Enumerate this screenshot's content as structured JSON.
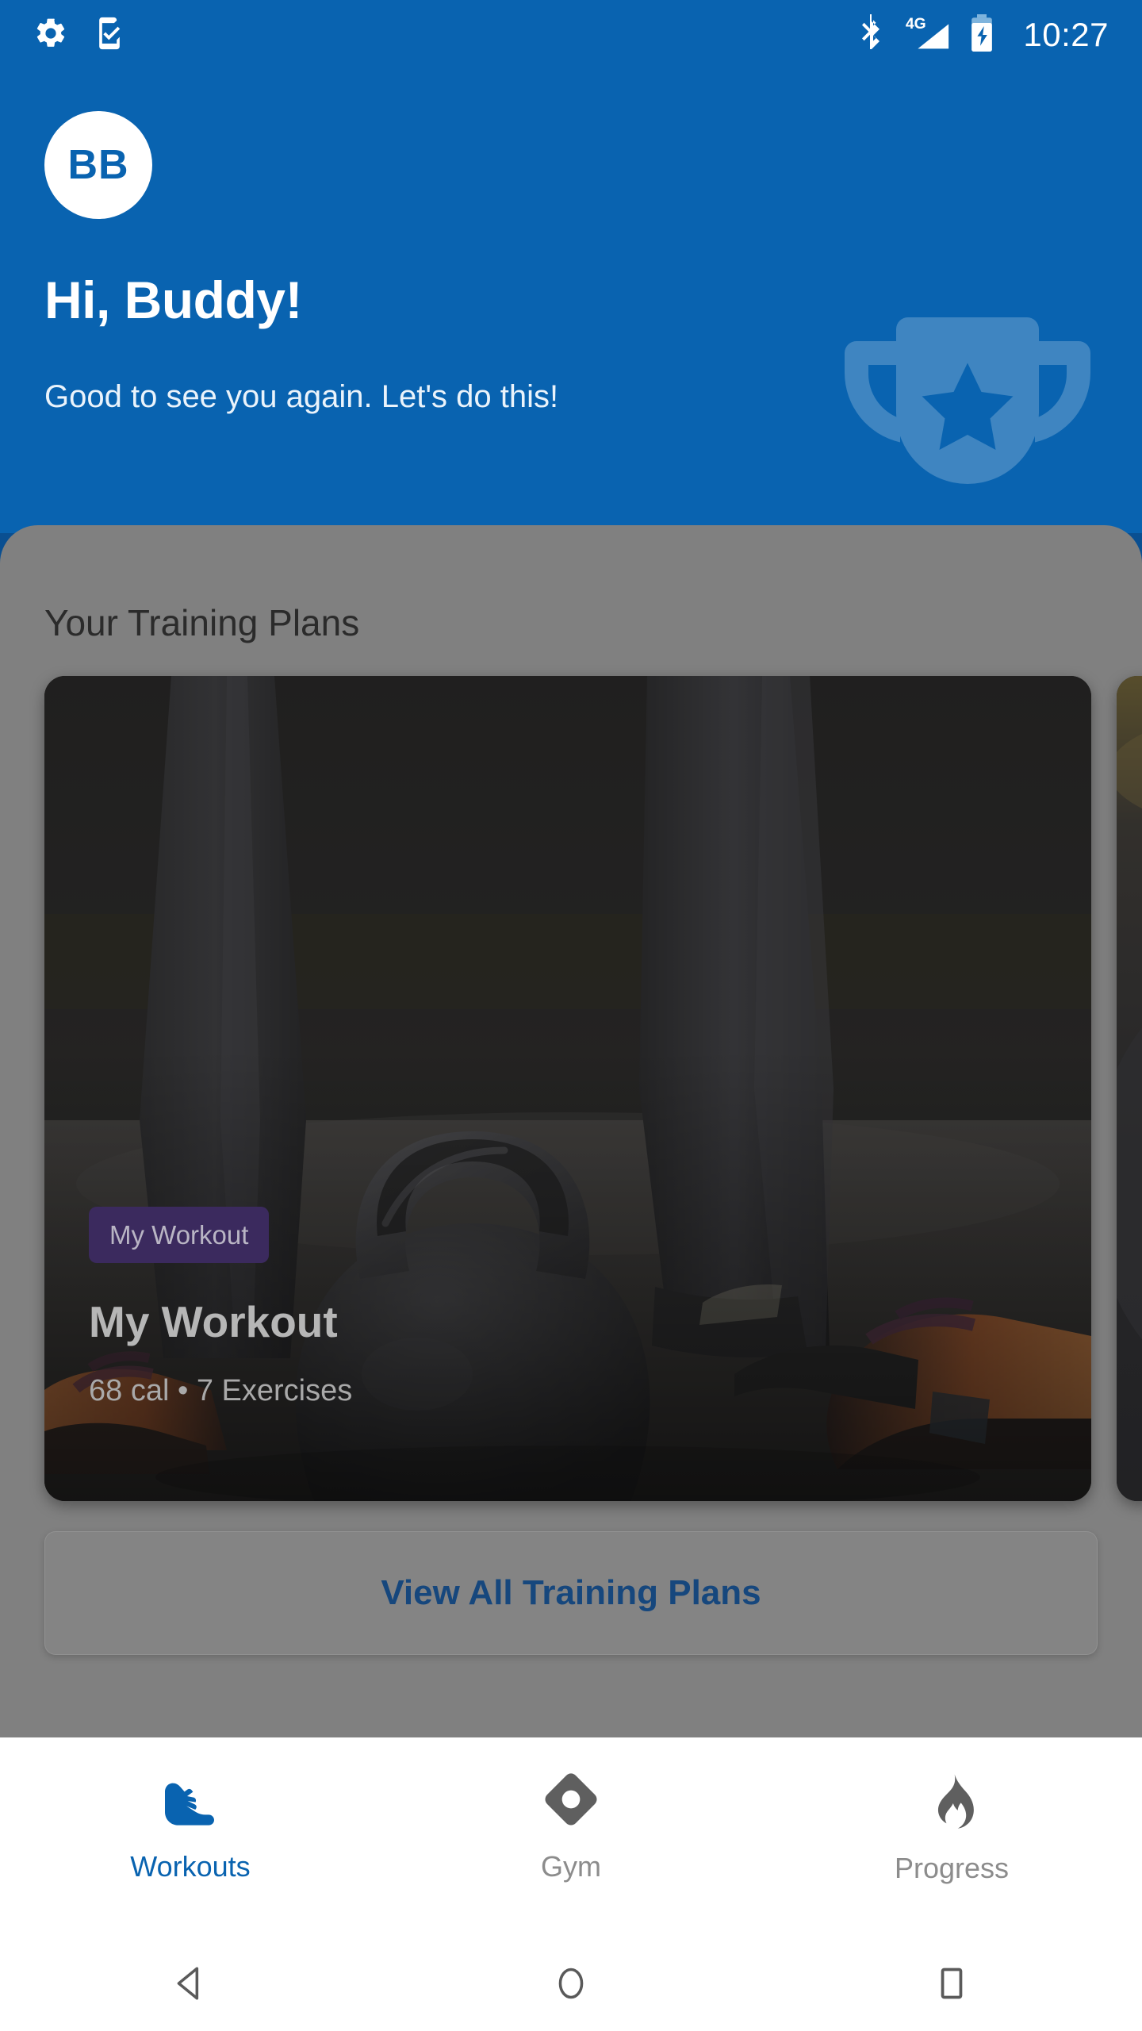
{
  "status_bar": {
    "time": "10:27",
    "icons": [
      "gear-icon",
      "phone-check-icon",
      "bluetooth-icon",
      "signal-4g-icon",
      "battery-charging-icon"
    ],
    "network_label": "4G"
  },
  "header": {
    "avatar_initials": "BB",
    "title": "Hi, Buddy!",
    "subtitle": "Good to see you again. Let's do this!",
    "decoration_icon": "trophy-icon",
    "background_color": "#0963b0"
  },
  "main": {
    "section_title": "Your Training Plans",
    "plans": [
      {
        "badge": "My Workout",
        "title": "My Workout",
        "meta": "68 cal • 7 Exercises",
        "badge_color": "#3b2a5e"
      }
    ],
    "view_all_label": "View All Training Plans",
    "view_all_color": "#16477d"
  },
  "bottom_nav": {
    "items": [
      {
        "label": "Workouts",
        "icon": "running-shoe-icon",
        "active": true
      },
      {
        "label": "Gym",
        "icon": "gym-diamond-icon",
        "active": false
      },
      {
        "label": "Progress",
        "icon": "flame-icon",
        "active": false
      }
    ],
    "active_color": "#0963b0",
    "inactive_color": "#8c8c8c"
  },
  "system_nav": {
    "buttons": [
      "back-triangle-icon",
      "home-circle-icon",
      "recents-square-icon"
    ]
  }
}
